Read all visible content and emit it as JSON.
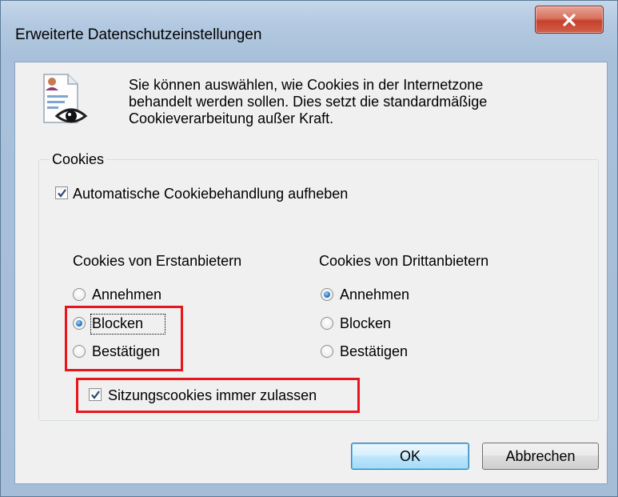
{
  "window": {
    "title": "Erweiterte Datenschutzeinstellungen",
    "close_icon": "close-icon"
  },
  "intro": {
    "icon": "privacy-document-eye-icon",
    "lines": [
      "Sie können auswählen, wie Cookies in der Internetzone",
      "behandelt werden sollen. Dies setzt die standardmäßige",
      "Cookieverarbeitung außer Kraft."
    ]
  },
  "cookies": {
    "group_label": "Cookies",
    "override_checkbox": {
      "label": "Automatische Cookiebehandlung aufheben",
      "checked": true
    },
    "first_party": {
      "heading": "Cookies von Erstanbietern",
      "options": [
        "Annehmen",
        "Blocken",
        "Bestätigen"
      ],
      "selected": "Blocken"
    },
    "third_party": {
      "heading": "Cookies von Drittanbietern",
      "options": [
        "Annehmen",
        "Blocken",
        "Bestätigen"
      ],
      "selected": "Annehmen"
    },
    "session_checkbox": {
      "label": "Sitzungscookies immer zulassen",
      "checked": true
    }
  },
  "buttons": {
    "ok": "OK",
    "cancel": "Abbrechen"
  },
  "colors": {
    "highlight": "#e8151c",
    "radio_selected": "#2c7cc6",
    "window_frame": "#a9c0da"
  }
}
